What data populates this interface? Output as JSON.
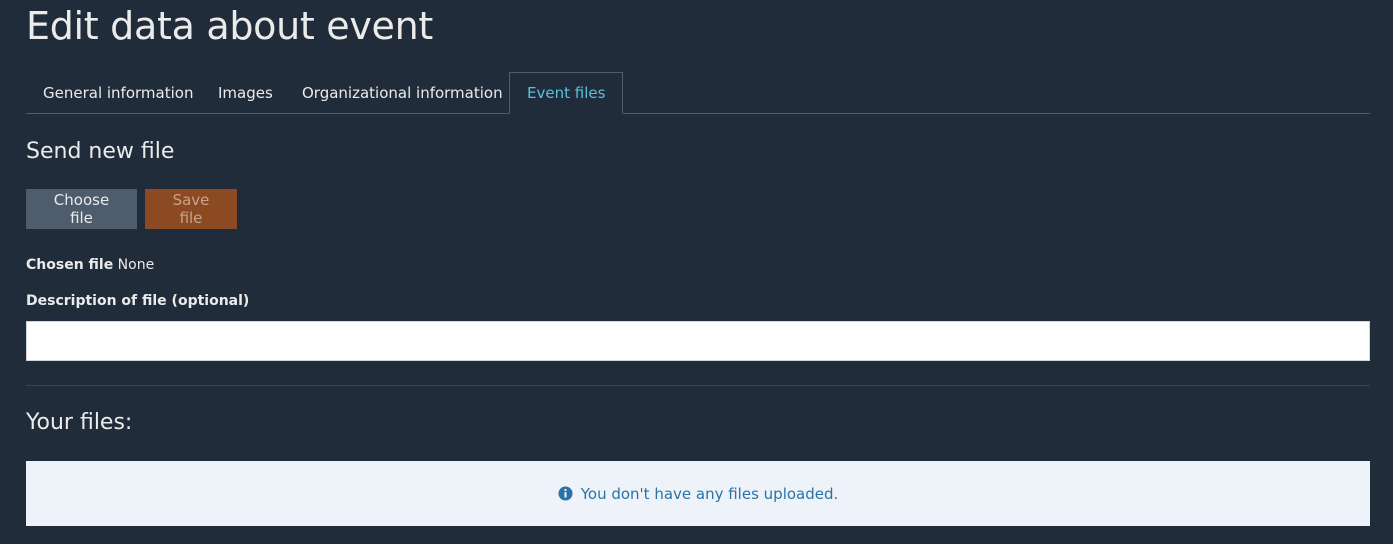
{
  "page": {
    "title": "Edit data about event"
  },
  "tabs": [
    {
      "label": "General information",
      "active": false
    },
    {
      "label": "Images",
      "active": false
    },
    {
      "label": "Organizational information",
      "active": false
    },
    {
      "label": "Event files",
      "active": true
    }
  ],
  "upload": {
    "heading": "Send new file",
    "choose_label": "Choose file",
    "save_label": "Save file",
    "chosen_label": "Chosen file",
    "chosen_value": "None",
    "description_label": "Description of file (optional)",
    "description_value": "",
    "description_placeholder": ""
  },
  "files": {
    "heading": "Your files:",
    "empty_message": "You don't have any files uploaded.",
    "empty_icon": "info-circle-icon"
  },
  "colors": {
    "background": "#212c3a",
    "active_tab": "#5bc0de",
    "save_button": "#8c4a23",
    "choose_button": "#4e5d6c",
    "info_text": "#2a73a6",
    "info_bg": "#eef3fa"
  }
}
